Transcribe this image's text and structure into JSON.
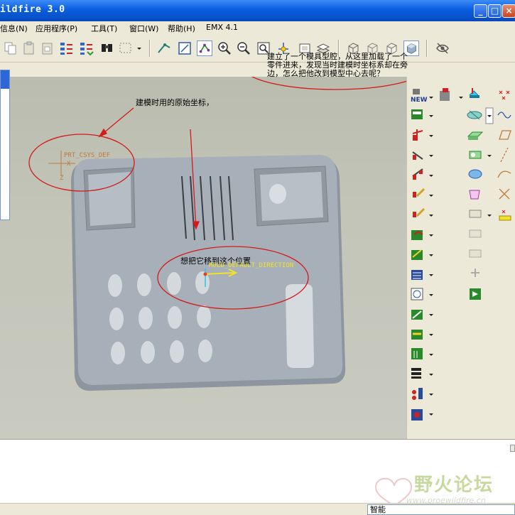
{
  "window": {
    "title": "ildfire 3.0",
    "minimize_glyph": "_",
    "maximize_glyph": "□",
    "close_glyph": "×"
  },
  "menu": {
    "items": [
      {
        "label": "信息(N)"
      },
      {
        "label": "应用程序(P)"
      },
      {
        "label": "工具(T)"
      },
      {
        "label": "窗口(W)"
      },
      {
        "label": "帮助(H)"
      },
      {
        "label": "EMX 4.1"
      }
    ]
  },
  "toolbar": {
    "icons": [
      "copy-icon",
      "paste-icon",
      "paste-special-icon",
      "regenerate-icon",
      "regen-manager-icon",
      "find-icon",
      "select-box-icon",
      "dropdown-icon",
      "repaint-icon",
      "refit-icon",
      "spin-center-icon",
      "zoom-in-icon",
      "zoom-out-icon",
      "zoom-fit-icon",
      "reorient-icon",
      "saved-views-icon",
      "layers-icon",
      "wireframe-icon",
      "hidden-line-icon",
      "no-hidden-icon",
      "shading-icon",
      "hide-datum-icon"
    ]
  },
  "viewport": {
    "annotations": {
      "top_note_line1": "建立了一个模具型腔，从这里加载了一个",
      "top_note_line2": "零件进来，发现当时建模时坐标系却在旁",
      "top_note_line3": "边，怎么把他改到模型中心去呢？",
      "original_csys_note": "建模时用的原始坐标，",
      "move_target_note": "想把它移到这个位置"
    },
    "labels": {
      "prt_csys": "PRT_CSYS_DEF",
      "mold_direction": "MOLD_DEFAULT_DIRECTION",
      "csys_x": "X",
      "csys_z": "Z"
    }
  },
  "right_toolbar": {
    "icons": [
      "new-part-icon",
      "mold-assembly-icon",
      "mold-base-icon",
      "datum-point-icon",
      "workpiece-icon",
      "parting-surface-icon",
      "sketch-curve-icon",
      "shrinkage-icon",
      "mold-volume-icon",
      "datum-plane-icon",
      "runner-icon",
      "extrude-icon",
      "datum-axis-icon",
      "gate-icon",
      "revolve-icon",
      "curve-icon",
      "waterline-icon",
      "volume-split-icon",
      "datum-csys-icon",
      "ejector-icon",
      "cavity-icon",
      "analysis-icon",
      "split-icon",
      "mold-opening-icon",
      "trim-icon",
      "merge-icon",
      "extract-icon",
      "pattern-icon",
      "layout-icon",
      "check-icon",
      "draft-check-icon",
      "thickness-icon",
      "interference-icon",
      "projected-area-icon",
      "bom-icon",
      "cooling-icon",
      "family-table-icon"
    ]
  },
  "status": {
    "filter_value": "智能"
  },
  "watermark": {
    "title": "野火论坛",
    "url": "www.proewildfire.cn"
  },
  "colors": {
    "titlebar": "#0a5ee0",
    "viewport_bg": "#c3c5b8",
    "part": "#a4adb4",
    "annotation_red": "#d41a1a",
    "csys_orange": "#c07a3a",
    "mold_yellow": "#f2e02a"
  }
}
